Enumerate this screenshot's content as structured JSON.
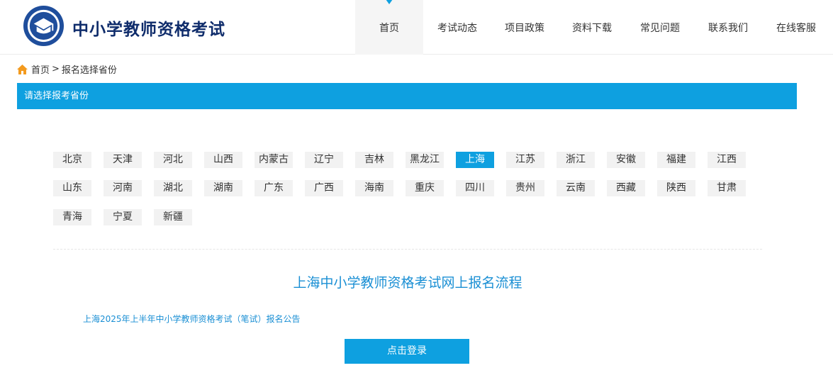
{
  "site": {
    "title": "中小学教师资格考试"
  },
  "nav": {
    "items": [
      {
        "label": "首页",
        "active": true
      },
      {
        "label": "考试动态",
        "active": false
      },
      {
        "label": "项目政策",
        "active": false
      },
      {
        "label": "资料下载",
        "active": false
      },
      {
        "label": "常见问题",
        "active": false
      },
      {
        "label": "联系我们",
        "active": false
      },
      {
        "label": "在线客服",
        "active": false
      }
    ]
  },
  "breadcrumb": {
    "home": "首页",
    "separator": ">",
    "current": "报名选择省份"
  },
  "section": {
    "title": "请选择报考省份"
  },
  "provinces": [
    {
      "label": "北京"
    },
    {
      "label": "天津"
    },
    {
      "label": "河北"
    },
    {
      "label": "山西"
    },
    {
      "label": "内蒙古"
    },
    {
      "label": "辽宁"
    },
    {
      "label": "吉林"
    },
    {
      "label": "黑龙江"
    },
    {
      "label": "上海",
      "active": true
    },
    {
      "label": "江苏"
    },
    {
      "label": "浙江"
    },
    {
      "label": "安徽"
    },
    {
      "label": "福建"
    },
    {
      "label": "江西"
    },
    {
      "label": "山东"
    },
    {
      "label": "河南"
    },
    {
      "label": "湖北"
    },
    {
      "label": "湖南"
    },
    {
      "label": "广东"
    },
    {
      "label": "广西"
    },
    {
      "label": "海南"
    },
    {
      "label": "重庆"
    },
    {
      "label": "四川"
    },
    {
      "label": "贵州"
    },
    {
      "label": "云南"
    },
    {
      "label": "西藏"
    },
    {
      "label": "陕西"
    },
    {
      "label": "甘肃"
    },
    {
      "label": "青海"
    },
    {
      "label": "宁夏"
    },
    {
      "label": "新疆"
    }
  ],
  "flow": {
    "title": "上海中小学教师资格考试网上报名流程",
    "notice": "上海2025年上半年中小学教师资格考试（笔试）报名公告",
    "login_label": "点击登录"
  },
  "colors": {
    "accent": "#0ea0e0",
    "link": "#1a8fd4",
    "brand": "#0f2c6b",
    "home_icon": "#f39a1e"
  },
  "icons": {
    "logo": "teacher-cert-emblem",
    "home": "home-icon",
    "nav_active": "caret-down-icon"
  }
}
